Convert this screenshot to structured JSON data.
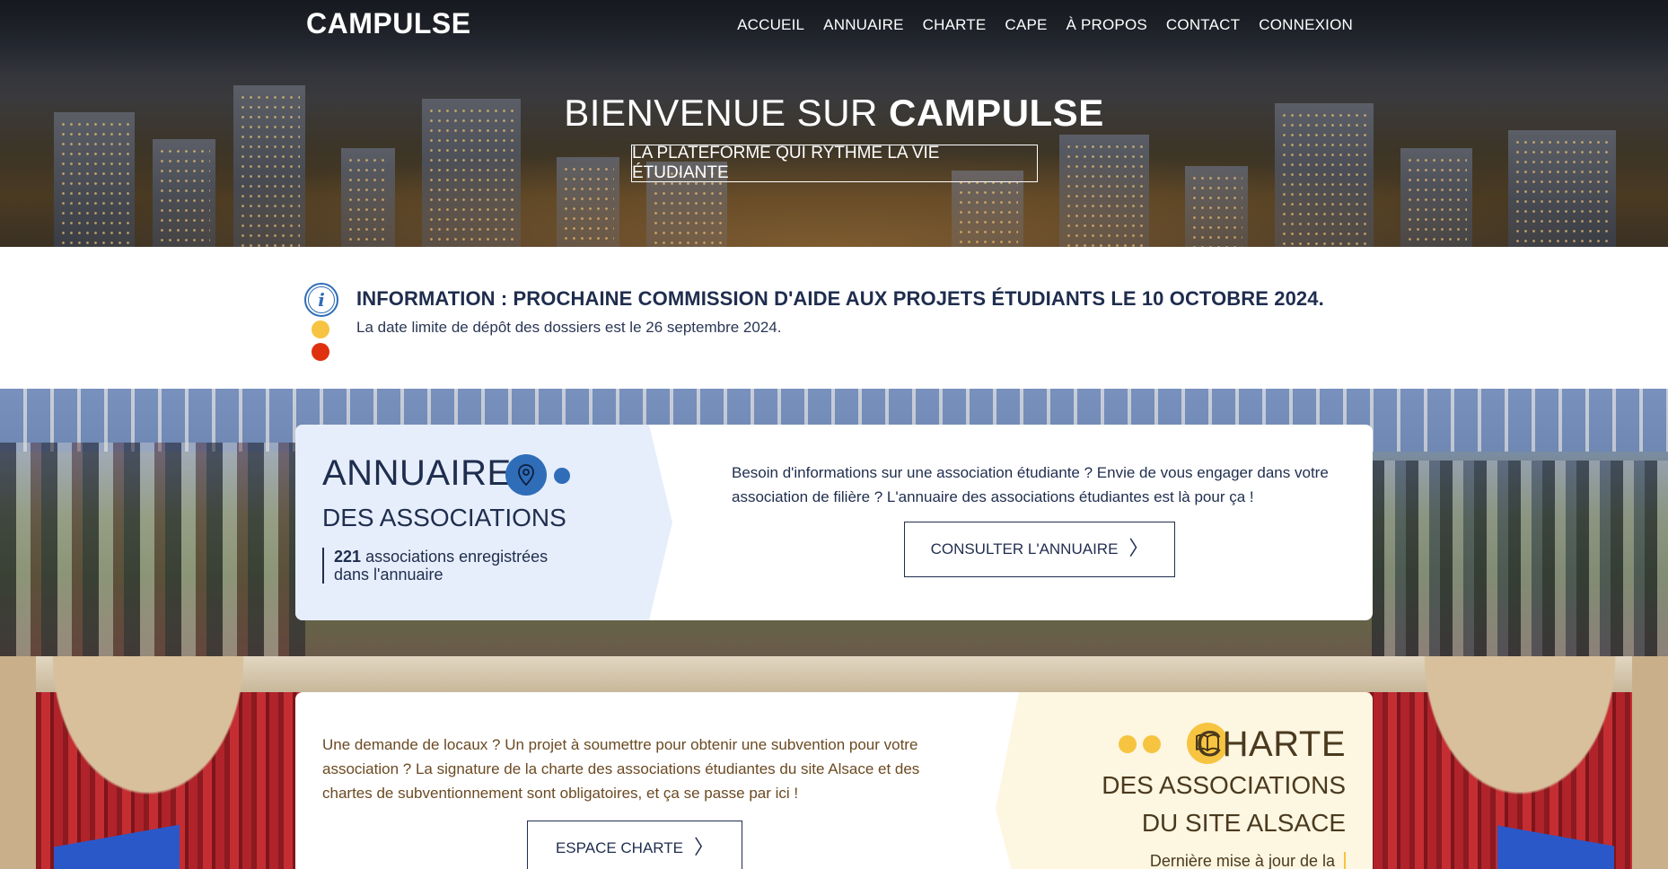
{
  "header": {
    "logo": "CAMPULSE",
    "nav": [
      "ACCUEIL",
      "ANNUAIRE",
      "CHARTE",
      "CAPE",
      "À PROPOS",
      "CONTACT",
      "CONNEXION"
    ]
  },
  "hero": {
    "title_prefix": "BIENVENUE SUR ",
    "title_brand": "CAMPULSE",
    "subtitle": "LA PLATEFORME QUI RYTHME LA VIE ÉTUDIANTE"
  },
  "info": {
    "title": "INFORMATION : PROCHAINE COMMISSION D'AIDE AUX PROJETS ÉTUDIANTS LE 10 OCTOBRE 2024.",
    "text": "La date limite de dépôt des dossiers est le 26 septembre 2024.",
    "icon": "info-icon"
  },
  "annuaire": {
    "title": "ANNUAIRE",
    "subtitle": "DES ASSOCIATIONS",
    "count": "221",
    "count_label": "associations enregistrées",
    "count_label2": "dans l'annuaire",
    "description": "Besoin d'informations sur une association étudiante ? Envie de vous engager dans votre association de filière ? L'annuaire des associations étudiantes est là pour ça !",
    "button": "CONSULTER L'ANNUAIRE",
    "icon": "map-pin-icon"
  },
  "charte": {
    "title": "CHARTE",
    "subtitle1": "DES ASSOCIATIONS",
    "subtitle2": "DU SITE ALSACE",
    "update": "Dernière mise à jour de la",
    "description": "Une demande de locaux ? Un projet à soumettre pour obtenir une subvention pour votre association ? La signature de la charte des associations étudiantes du site Alsace et des chartes de subventionnement sont obligatoires, et ça se passe par ici !",
    "button": "ESPACE CHARTE",
    "icon": "book-icon"
  },
  "colors": {
    "navy": "#1f2d4e",
    "blue": "#2f6db8",
    "yellow": "#f6c441",
    "red": "#e0310f",
    "annuaire_bg": "#e6eefb",
    "charte_bg": "#fdf6e1"
  }
}
